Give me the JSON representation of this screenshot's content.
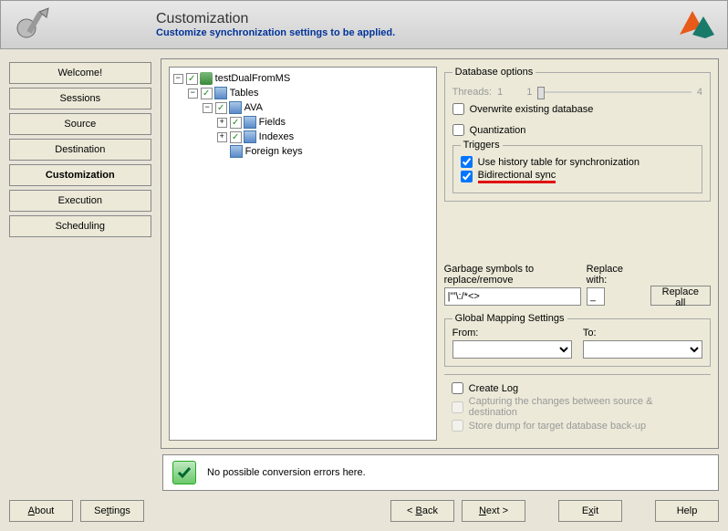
{
  "header": {
    "title": "Customization",
    "subtitle": "Customize synchronization settings to be applied."
  },
  "sidebar": {
    "items": [
      {
        "label": "Welcome!",
        "active": false
      },
      {
        "label": "Sessions",
        "active": false
      },
      {
        "label": "Source",
        "active": false
      },
      {
        "label": "Destination",
        "active": false
      },
      {
        "label": "Customization",
        "active": true
      },
      {
        "label": "Execution",
        "active": false
      },
      {
        "label": "Scheduling",
        "active": false
      }
    ]
  },
  "tree": {
    "root": "testDualFromMS",
    "tables_label": "Tables",
    "table_name": "AVA",
    "fields_label": "Fields",
    "indexes_label": "Indexes",
    "fk_label": "Foreign keys"
  },
  "options": {
    "db_legend": "Database options",
    "threads_label": "Threads:",
    "threads_min": "1",
    "threads_val": "1",
    "threads_max": "4",
    "overwrite_label": "Overwrite existing database",
    "quant_label": "Quantization",
    "triggers_legend": "Triggers",
    "history_label": "Use history table for synchronization",
    "bidir_label": "Bidirectional sync",
    "garbage_label": "Garbage symbols to replace/remove",
    "garbage_value": "|'\"\\:/*<>",
    "replace_label": "Replace with:",
    "replace_value": "_",
    "replace_all_btn": "Replace all",
    "mapping_legend": "Global Mapping Settings",
    "from_label": "From:",
    "to_label": "To:",
    "createlog_label": "Create Log",
    "capture_label": "Capturing the changes between source & destination",
    "dump_label": "Store dump for target database back-up"
  },
  "status": {
    "message": "No possible conversion errors here."
  },
  "footer": {
    "about": "About",
    "settings": "Settings",
    "back": "< Back",
    "next": "Next >",
    "exit": "Exit",
    "help": "Help"
  }
}
